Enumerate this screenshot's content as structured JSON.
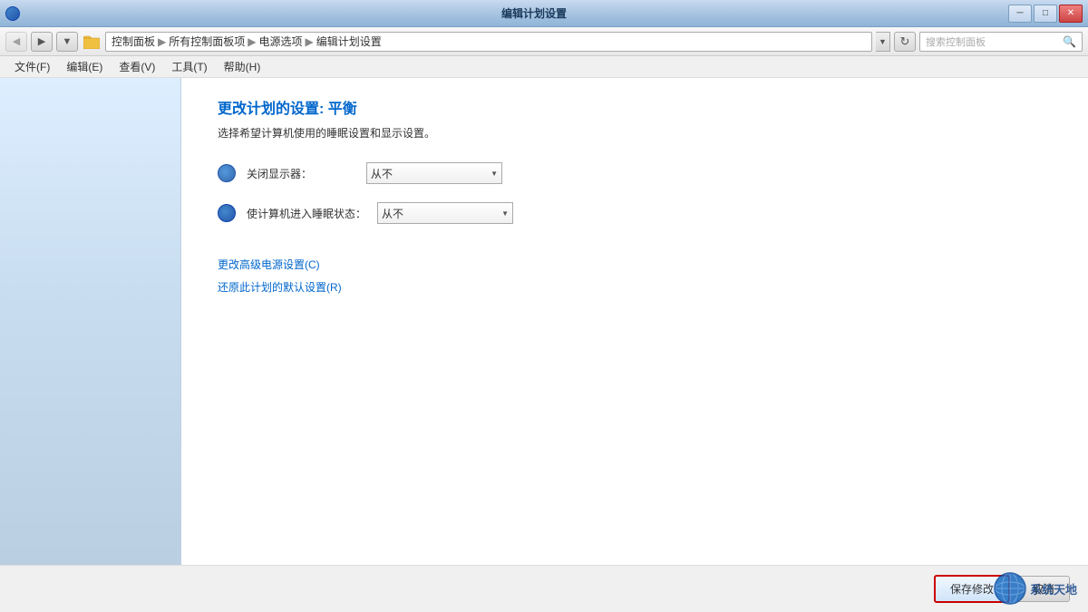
{
  "titleBar": {
    "title": "编辑计划设置",
    "minBtn": "─",
    "maxBtn": "□",
    "closeBtn": "✕"
  },
  "addressBar": {
    "backBtn": "◀",
    "forwardBtn": "▶",
    "downBtn": "▼",
    "refreshBtn": "↻",
    "path": {
      "part1": "控制面板",
      "sep1": "▶",
      "part2": "所有控制面板项",
      "sep2": "▶",
      "part3": "电源选项",
      "sep3": "▶",
      "part4": "编辑计划设置"
    },
    "dropdownArrow": "▼",
    "searchPlaceholder": "搜索控制面板",
    "searchIcon": "🔍"
  },
  "menuBar": {
    "items": [
      {
        "label": "文件(F)"
      },
      {
        "label": "编辑(E)"
      },
      {
        "label": "查看(V)"
      },
      {
        "label": "工具(T)"
      },
      {
        "label": "帮助(H)"
      }
    ]
  },
  "content": {
    "pageTitle": "更改计划的设置: 平衡",
    "pageSubtitle": "选择希望计算机使用的睡眠设置和显示设置。",
    "settings": [
      {
        "id": "monitor",
        "label": "关闭显示器：",
        "value": "从不",
        "iconType": "monitor"
      },
      {
        "id": "sleep",
        "label": "使计算机进入睡眠状态：",
        "value": "从不",
        "iconType": "sleep"
      }
    ],
    "links": [
      {
        "label": "更改高级电源设置(C)"
      },
      {
        "label": "还原此计划的默认设置(R)"
      }
    ],
    "buttons": {
      "save": "保存修改",
      "cancel": "取消"
    }
  },
  "watermark": {
    "text": "系统天地"
  }
}
